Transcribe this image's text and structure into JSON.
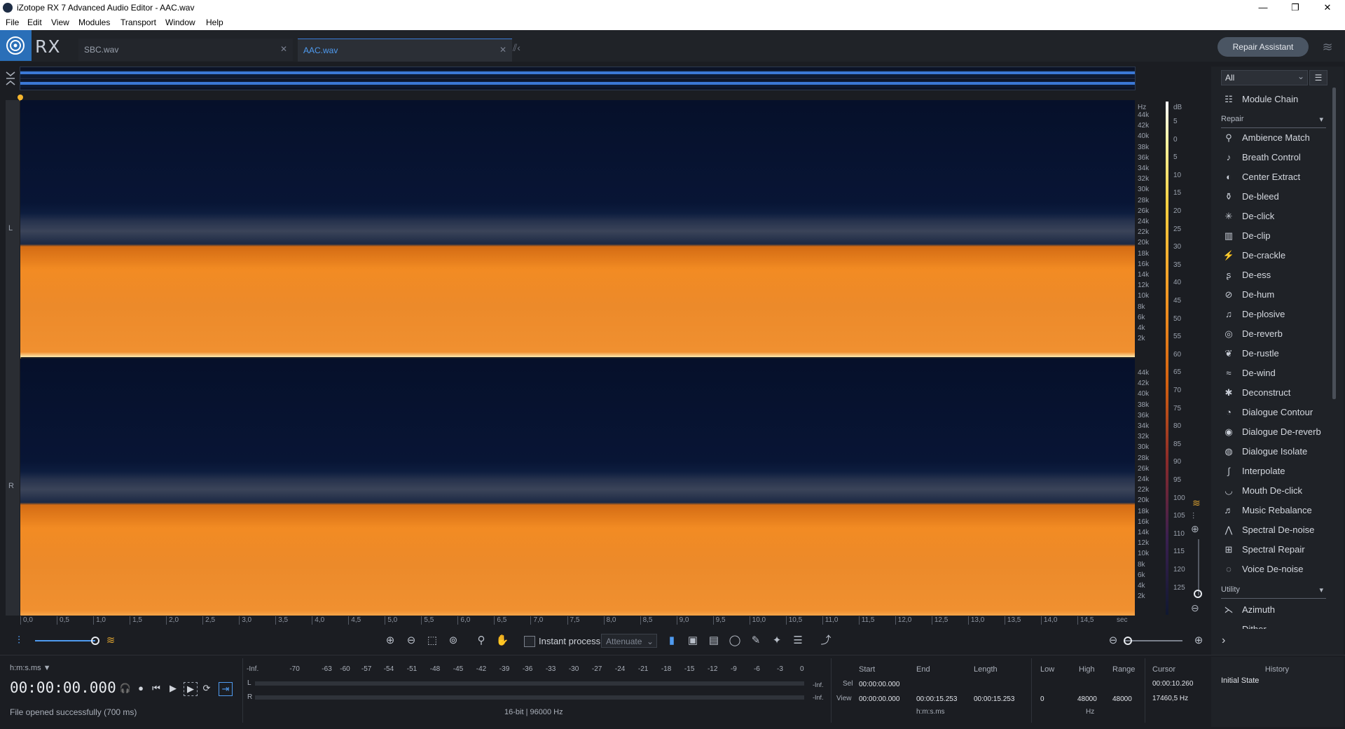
{
  "window": {
    "title": "iZotope RX 7 Advanced Audio Editor - AAC.wav",
    "minimize": "—",
    "maximize": "❐",
    "close": "✕"
  },
  "menu": [
    "File",
    "Edit",
    "View",
    "Modules",
    "Transport",
    "Window",
    "Help"
  ],
  "logo_text": "RX",
  "tabs": [
    {
      "label": "SBC.wav",
      "close": "✕",
      "active": false
    },
    {
      "label": "AAC.wav",
      "close": "✕",
      "active": true
    }
  ],
  "repair_assistant": "Repair Assistant",
  "channels": {
    "left": "L",
    "right": "R"
  },
  "hz_scale": {
    "unit": "Hz",
    "ticks": [
      "44k",
      "42k",
      "40k",
      "38k",
      "36k",
      "34k",
      "32k",
      "30k",
      "28k",
      "26k",
      "24k",
      "22k",
      "20k",
      "18k",
      "16k",
      "14k",
      "12k",
      "10k",
      "8k",
      "6k",
      "4k",
      "2k"
    ]
  },
  "db_scale": {
    "unit": "dB",
    "ticks": [
      "5",
      "0",
      "5",
      "10",
      "15",
      "20",
      "25",
      "30",
      "35",
      "40",
      "45",
      "50",
      "55",
      "60",
      "65",
      "70",
      "75",
      "80",
      "85",
      "90",
      "95",
      "100",
      "105",
      "110",
      "115",
      "120",
      "125"
    ]
  },
  "time_ruler": {
    "ticks": [
      "0,0",
      "0,5",
      "1,0",
      "1,5",
      "2,0",
      "2,5",
      "3,0",
      "3,5",
      "4,0",
      "4,5",
      "5,0",
      "5,5",
      "6,0",
      "6,5",
      "7,0",
      "7,5",
      "8,0",
      "8,5",
      "9,0",
      "9,5",
      "10,0",
      "10,5",
      "11,0",
      "11,5",
      "12,0",
      "12,5",
      "13,0",
      "13,5",
      "14,0",
      "14,5"
    ],
    "unit": "sec"
  },
  "toolbar": {
    "instant_process": "Instant process",
    "mode": "Attenuate"
  },
  "module_panel": {
    "filter": "All",
    "module_chain": "Module Chain",
    "repair_header": "Repair",
    "repair_modules": [
      {
        "label": "Ambience Match",
        "icon": "ambience-match-icon"
      },
      {
        "label": "Breath Control",
        "icon": "breath-control-icon"
      },
      {
        "label": "Center Extract",
        "icon": "center-extract-icon"
      },
      {
        "label": "De-bleed",
        "icon": "de-bleed-icon"
      },
      {
        "label": "De-click",
        "icon": "de-click-icon"
      },
      {
        "label": "De-clip",
        "icon": "de-clip-icon"
      },
      {
        "label": "De-crackle",
        "icon": "de-crackle-icon"
      },
      {
        "label": "De-ess",
        "icon": "de-ess-icon"
      },
      {
        "label": "De-hum",
        "icon": "de-hum-icon"
      },
      {
        "label": "De-plosive",
        "icon": "de-plosive-icon"
      },
      {
        "label": "De-reverb",
        "icon": "de-reverb-icon"
      },
      {
        "label": "De-rustle",
        "icon": "de-rustle-icon"
      },
      {
        "label": "De-wind",
        "icon": "de-wind-icon"
      },
      {
        "label": "Deconstruct",
        "icon": "deconstruct-icon"
      },
      {
        "label": "Dialogue Contour",
        "icon": "dialogue-contour-icon"
      },
      {
        "label": "Dialogue De-reverb",
        "icon": "dialogue-de-reverb-icon"
      },
      {
        "label": "Dialogue Isolate",
        "icon": "dialogue-isolate-icon"
      },
      {
        "label": "Interpolate",
        "icon": "interpolate-icon"
      },
      {
        "label": "Mouth De-click",
        "icon": "mouth-de-click-icon"
      },
      {
        "label": "Music Rebalance",
        "icon": "music-rebalance-icon"
      },
      {
        "label": "Spectral De-noise",
        "icon": "spectral-de-noise-icon"
      },
      {
        "label": "Spectral Repair",
        "icon": "spectral-repair-icon"
      },
      {
        "label": "Voice De-noise",
        "icon": "voice-de-noise-icon"
      }
    ],
    "utility_header": "Utility",
    "utility_modules": [
      {
        "label": "Azimuth",
        "icon": "azimuth-icon"
      },
      {
        "label": "Dither",
        "icon": "dither-icon"
      }
    ]
  },
  "transport": {
    "time_format": "h:m:s.ms ▼",
    "timecode": "00:00:00.000",
    "status": "File opened successfully (700 ms)"
  },
  "meter": {
    "scale": [
      "-Inf.",
      "-70",
      "-63",
      "-60",
      "-57",
      "-54",
      "-51",
      "-48",
      "-45",
      "-42",
      "-39",
      "-36",
      "-33",
      "-30",
      "-27",
      "-24",
      "-21",
      "-18",
      "-15",
      "-12",
      "-9",
      "-6",
      "-3",
      "0"
    ],
    "left_label": "L",
    "right_label": "R",
    "left_value": "-Inf.",
    "right_value": "-Inf.",
    "format": "16-bit | 96000 Hz"
  },
  "selection": {
    "headers": {
      "start": "Start",
      "end": "End",
      "length": "Length",
      "low": "Low",
      "high": "High",
      "range": "Range",
      "cursor": "Cursor"
    },
    "sel_label": "Sel",
    "view_label": "View",
    "sel_start": "00:00:00.000",
    "view_start": "00:00:00.000",
    "view_end": "00:00:15.253",
    "view_length": "00:00:15.253",
    "low": "0",
    "high": "48000",
    "range": "48000",
    "cursor_time": "00:00:10.260",
    "cursor_freq": "17460,5 Hz",
    "time_unit": "h:m:s.ms",
    "freq_unit": "Hz"
  },
  "history": {
    "title": "History",
    "items": [
      "Initial State"
    ]
  },
  "colors": {
    "accent": "#2a6fb8",
    "spectrogram_hot": "#f28b23",
    "spectrogram_cold": "#06102a",
    "panel": "#1f2227"
  }
}
